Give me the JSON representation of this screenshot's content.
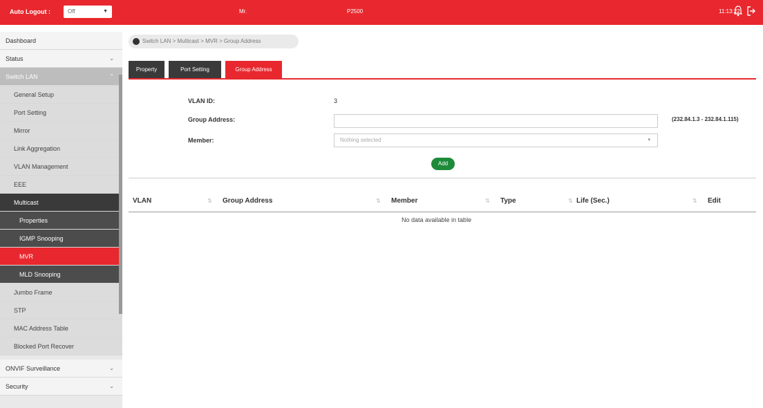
{
  "header": {
    "auto_logout_label": "Auto Logout :",
    "auto_logout_value": "Off",
    "model": "Mr.",
    "product": "P2500",
    "time": "11:13:22"
  },
  "sidebar": {
    "items": [
      {
        "label": "Dashboard"
      },
      {
        "label": "Status"
      },
      {
        "label": "Switch LAN"
      },
      {
        "label": "General Setup"
      },
      {
        "label": "Port Setting"
      },
      {
        "label": "Mirror"
      },
      {
        "label": "Link Aggregation"
      },
      {
        "label": "VLAN Management"
      },
      {
        "label": "EEE"
      },
      {
        "label": "Multicast"
      },
      {
        "label": "Properties"
      },
      {
        "label": "IGMP Snooping"
      },
      {
        "label": "MVR"
      },
      {
        "label": "MLD Snooping"
      },
      {
        "label": "Jumbo Frame"
      },
      {
        "label": "STP"
      },
      {
        "label": "MAC Address Table"
      },
      {
        "label": "Blocked Port Recover"
      },
      {
        "label": "ONVIF Surveillance"
      },
      {
        "label": "Security"
      }
    ]
  },
  "breadcrumb": "Switch LAN > Multicast > MVR > Group Address",
  "tabs": [
    {
      "label": "Property"
    },
    {
      "label": "Port Setting"
    },
    {
      "label": "Group Address"
    }
  ],
  "form": {
    "vlan_label": "VLAN ID:",
    "vlan_value": "3",
    "group_label": "Group Address:",
    "group_hint": "(232.84.1.3 - 232.84.1.115)",
    "member_label": "Member:",
    "member_placeholder": "Nothing selected",
    "add_label": "Add"
  },
  "table": {
    "columns": [
      "VLAN",
      "Group Address",
      "Member",
      "Type",
      "Life (Sec.)",
      "Edit"
    ],
    "empty_text": "No data available in table"
  },
  "colors": {
    "accent": "#e8282e",
    "dark": "#3a3a3a",
    "add": "#1e8b3a"
  }
}
